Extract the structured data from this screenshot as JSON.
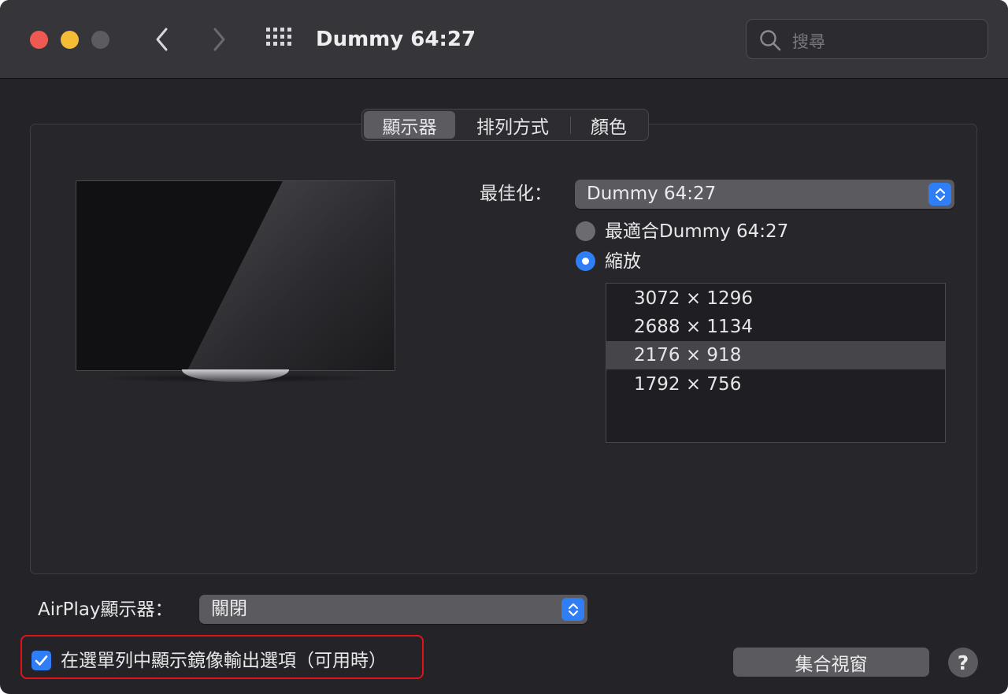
{
  "window": {
    "title": "Dummy 64:27"
  },
  "toolbar": {
    "search_placeholder": "搜尋",
    "back_icon": "chevron-left-icon",
    "forward_icon": "chevron-right-icon",
    "grid_icon": "show-all-grid-icon"
  },
  "tabs": [
    {
      "label": "顯示器",
      "active": true
    },
    {
      "label": "排列方式",
      "active": false
    },
    {
      "label": "顏色",
      "active": false
    }
  ],
  "optimize": {
    "label": "最佳化：",
    "value": "Dummy 64:27",
    "options": [
      {
        "label": "最適合Dummy 64:27",
        "selected": false
      },
      {
        "label": "縮放",
        "selected": true
      }
    ]
  },
  "resolutions": {
    "items": [
      "3072 × 1296",
      "2688 × 1134",
      "2176 × 918",
      "1792 × 756"
    ],
    "selected_index": 2
  },
  "airplay": {
    "label": "AirPlay顯示器：",
    "value": "關閉"
  },
  "mirror_option": {
    "label": "在選單列中顯示鏡像輸出選項（可用時）",
    "checked": true
  },
  "buttons": {
    "gather": "集合視窗",
    "help": "?"
  },
  "colors": {
    "accent": "#2f7ef5",
    "highlight_border": "#e0131b",
    "window_bg": "#242428",
    "titlebar_bg": "#36363a"
  }
}
